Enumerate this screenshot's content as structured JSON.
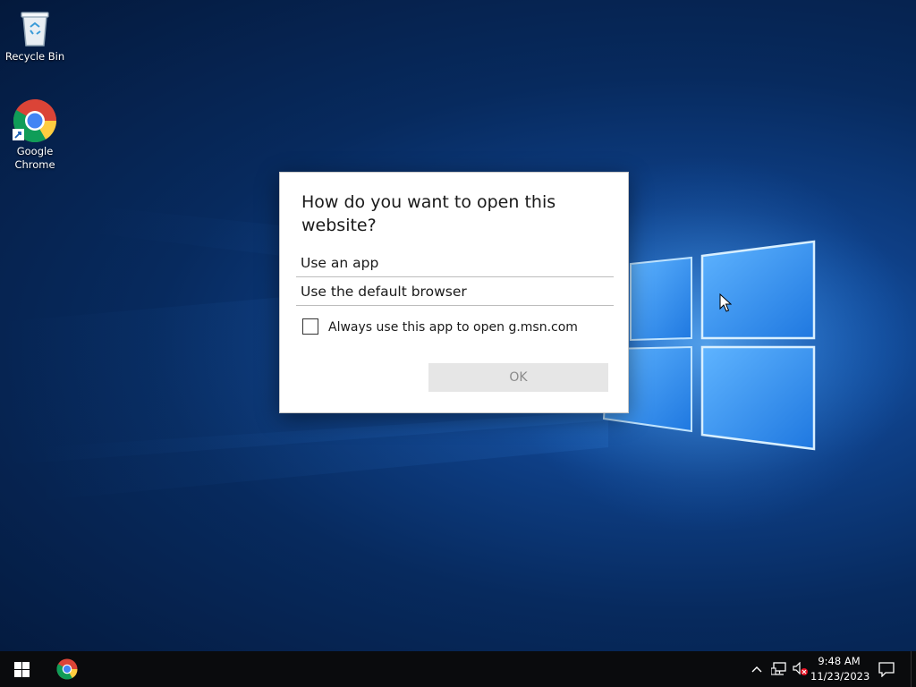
{
  "desktop": {
    "icons": [
      {
        "label": "Recycle Bin",
        "icon": "recycle-bin-icon"
      },
      {
        "label": "Google\nChrome",
        "icon": "chrome-icon"
      }
    ]
  },
  "dialog": {
    "title": "How do you want to open this website?",
    "options": [
      "Use an app",
      "Use the default browser"
    ],
    "checkbox": {
      "label": "Always use this app to open g.msn.com",
      "checked": false
    },
    "ok_label": "OK",
    "ok_enabled": false
  },
  "taskbar": {
    "start_icon": "windows-logo-icon",
    "pinned": [
      {
        "name": "Google Chrome",
        "icon": "chrome-icon"
      }
    ],
    "tray": {
      "icons": [
        "chevron-up-icon",
        "network-icon",
        "volume-muted-icon"
      ],
      "time": "9:48 AM",
      "date": "11/23/2023",
      "notification_icon": "action-center-icon"
    }
  },
  "colors": {
    "dialog_bg": "#ffffff",
    "ok_button_bg": "#e6e6e6",
    "taskbar_bg": "#0a0b0d",
    "desktop_accent": "#1e6fd1"
  }
}
